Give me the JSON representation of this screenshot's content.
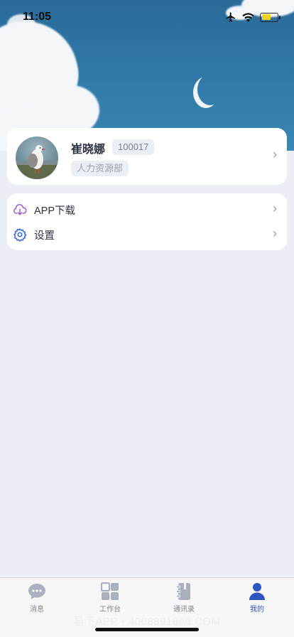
{
  "status_bar": {
    "time": "11:05"
  },
  "profile": {
    "name": "崔晓娜",
    "employee_id": "100017",
    "department": "人力资源部"
  },
  "menu": {
    "items": [
      {
        "label": "APP下载",
        "icon": "cloud-download-icon"
      },
      {
        "label": "设置",
        "icon": "gear-icon"
      }
    ]
  },
  "tabs": [
    {
      "label": "消息",
      "icon": "chat-bubble-icon"
    },
    {
      "label": "工作台",
      "icon": "grid-icon"
    },
    {
      "label": "通讯录",
      "icon": "address-book-icon"
    },
    {
      "label": "我的",
      "icon": "person-icon",
      "active": true
    }
  ],
  "watermark": "易下APP • 4008891800.COM",
  "colors": {
    "accent": "#2e55c4",
    "download_icon": "#a35bd8",
    "settings_icon": "#3f6fd8",
    "battery": "#f2d41c"
  }
}
